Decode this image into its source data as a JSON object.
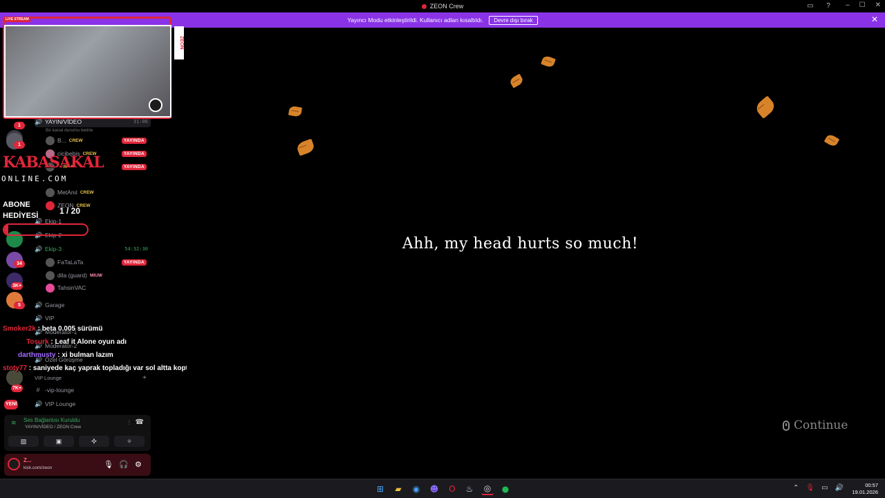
{
  "window": {
    "title": "ZEON Crew",
    "controls": {
      "minimize": "–",
      "maximize": "☐",
      "close": "✕"
    }
  },
  "banner": {
    "text": "Yayıncı Modu etkinleştirildi. Kullanıcı adları kısaltıldı.",
    "button_label": "Devre dışı bırak",
    "close": "✕"
  },
  "rail": {
    "badges": [
      "1",
      "1",
      "34",
      "3K+",
      "5",
      "7K+"
    ],
    "new_label": "YENİ"
  },
  "channels": {
    "voice_yayin": {
      "name": "YAYIN/VİDEO",
      "status": "Bir kanal durumu belirle",
      "timer": "31:06"
    },
    "yayin_users": [
      {
        "name": "B...",
        "tag": "CREW",
        "live": "YAYINDA"
      },
      {
        "name": "cicibebis",
        "tag": "CREW",
        "live": "YAYINDA"
      },
      {
        "name": "",
        "tag": "CREW",
        "live": "YAYINDA"
      },
      {
        "name": "MetAnıl",
        "tag": "CREW",
        "live": ""
      },
      {
        "name": "ZEON",
        "tag": "CREW",
        "live": ""
      }
    ],
    "ekip1": "Ekip-1",
    "ekip2": "Ekip-2",
    "ekip3": {
      "name": "Ekip-3",
      "timer": "54:32:30"
    },
    "ekip3_users": [
      {
        "name": "FaTaLaTa",
        "tag": "",
        "live": "YAYINDA"
      },
      {
        "name": "dila (guard)",
        "tag": "MIUW",
        "live": ""
      },
      {
        "name": "TahsinVAC",
        "tag": "",
        "live": ""
      }
    ],
    "garage": "Garage",
    "vip": "VIP",
    "moderator1": "Moderatör-1",
    "moderator2": "Moderatör-2",
    "ozel": "Özel Görüşme",
    "vip_lounge_category": "VIP Lounge",
    "vip_lounge_text": "-vip-lounge",
    "vip_lounge_voice": "VIP Lounge"
  },
  "voice_panel": {
    "status": "Ses Bağlantısı Kuruldu",
    "channel": "YAYIN/VİDEO / ZEON Crew"
  },
  "user_panel": {
    "name": "Z...",
    "status": "kick.com/zeon"
  },
  "overlay": {
    "live_badge": "LIVE STREAM",
    "side_brand": "ZEON",
    "sponsor_name": "KABASAKAL",
    "sponsor_sub": "ONLINE.COM",
    "sub_gift_line1": "ABONE",
    "sub_gift_line2": "HEDİYESİ",
    "gift_count": "1 / 20",
    "gift_progress": 0.05
  },
  "chat": [
    {
      "user": "Smoker2k",
      "text": ": beta 0.005 sürümü"
    },
    {
      "user": "Tosurk",
      "text": ": Leaf it Alone oyun adı"
    },
    {
      "user": "darthmusty",
      "text": ": xi bulman lazım"
    },
    {
      "user": "stoty77",
      "text": ": saniyede kaç yaprak topladığı var sol altta koptum ya"
    }
  ],
  "game": {
    "dialogue": "Ahh, my head hurts so much!",
    "continue_label": "Continue"
  },
  "taskbar": {
    "time": "00:57",
    "date": "19.01.2026"
  },
  "colors": {
    "banner": "#8a33e6",
    "live_red": "#e0263a",
    "connected_green": "#3ba55d",
    "leaf_orange": "#d7832a"
  }
}
